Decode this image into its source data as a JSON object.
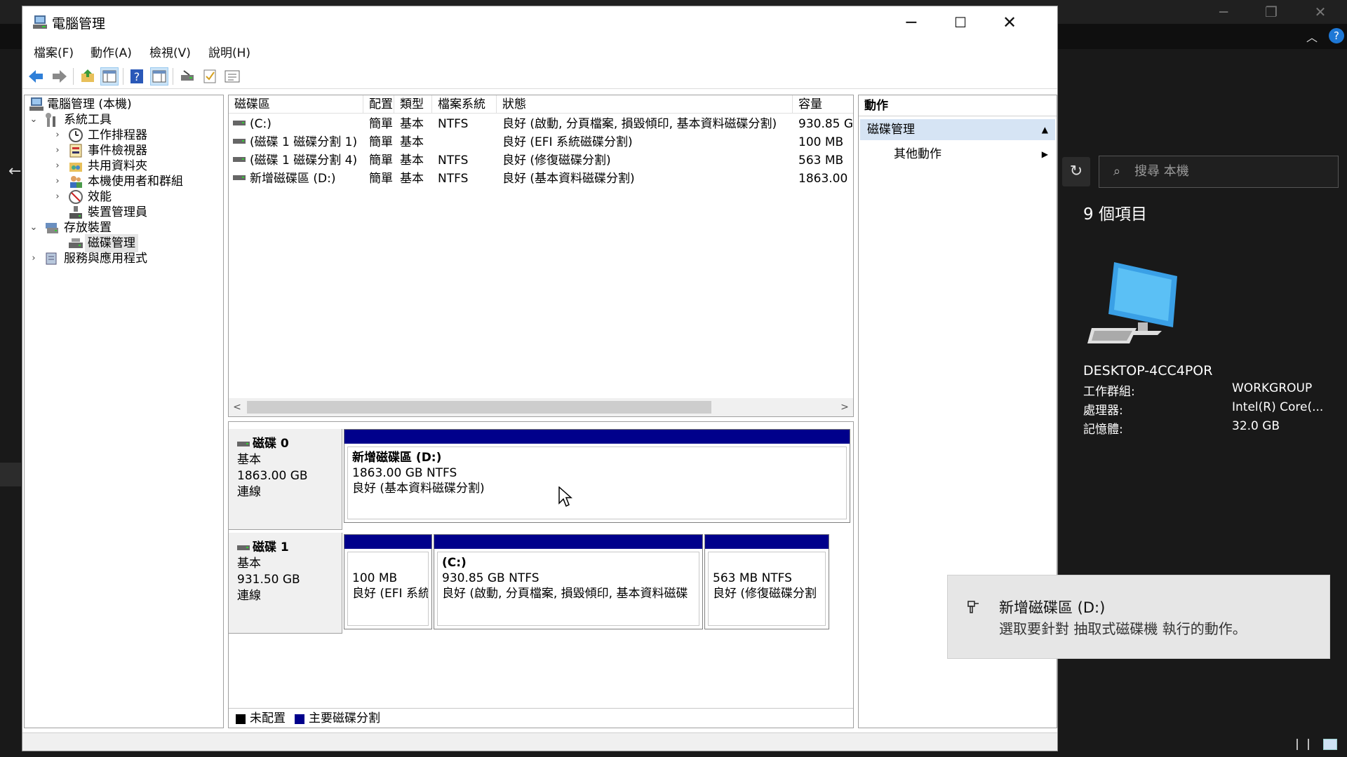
{
  "explorer": {
    "search_placeholder": "搜尋 本機",
    "item_count": "9 個項目",
    "pc_name": "DESKTOP-4CC4POR",
    "info": [
      {
        "key": "工作群組:",
        "value": "WORKGROUP"
      },
      {
        "key": "處理器:",
        "value": "Intel(R) Core(..."
      },
      {
        "key": "記憶體:",
        "value": "32.0 GB"
      }
    ]
  },
  "window": {
    "title": "電腦管理"
  },
  "menu": [
    "檔案(F)",
    "動作(A)",
    "檢視(V)",
    "說明(H)"
  ],
  "tree": {
    "root": "電腦管理 (本機)",
    "system_tools": "系統工具",
    "task_scheduler": "工作排程器",
    "event_viewer": "事件檢視器",
    "shared_folders": "共用資料夾",
    "local_users": "本機使用者和群組",
    "performance": "效能",
    "device_manager": "裝置管理員",
    "storage": "存放裝置",
    "disk_management": "磁碟管理",
    "services_apps": "服務與應用程式"
  },
  "list": {
    "headers": [
      "磁碟區",
      "配置",
      "類型",
      "檔案系統",
      "狀態",
      "容量"
    ],
    "rows": [
      [
        "(C:)",
        "簡單",
        "基本",
        "NTFS",
        "良好 (啟動, 分頁檔案, 損毀傾印, 基本資料磁碟分割)",
        "930.85 G"
      ],
      [
        "(磁碟 1 磁碟分割 1)",
        "簡單",
        "基本",
        "",
        "良好 (EFI 系統磁碟分割)",
        "100 MB"
      ],
      [
        "(磁碟 1 磁碟分割 4)",
        "簡單",
        "基本",
        "NTFS",
        "良好 (修復磁碟分割)",
        "563 MB"
      ],
      [
        "新增磁碟區 (D:)",
        "簡單",
        "基本",
        "NTFS",
        "良好 (基本資料磁碟分割)",
        "1863.00"
      ]
    ]
  },
  "disks": [
    {
      "name": "磁碟 0",
      "type": "基本",
      "size": "1863.00 GB",
      "status": "連線",
      "partitions": [
        {
          "name": "新增磁碟區 (D:)",
          "size": "1863.00 GB NTFS",
          "status": "良好 (基本資料磁碟分割)"
        }
      ]
    },
    {
      "name": "磁碟 1",
      "type": "基本",
      "size": "931.50 GB",
      "status": "連線",
      "partitions": [
        {
          "name": "",
          "size": "100 MB",
          "status": "良好 (EFI 系統"
        },
        {
          "name": "(C:)",
          "size": "930.85 GB NTFS",
          "status": "良好 (啟動, 分頁檔案, 損毀傾印, 基本資料磁碟"
        },
        {
          "name": "",
          "size": "563 MB NTFS",
          "status": "良好 (修復磁碟分割"
        }
      ]
    }
  ],
  "legend": {
    "unallocated": "未配置",
    "primary": "主要磁碟分割"
  },
  "actions": {
    "header": "動作",
    "section": "磁碟管理",
    "more": "其他動作"
  },
  "toast": {
    "title": "新增磁碟區 (D:)",
    "body": "選取要針對 抽取式磁碟機 執行的動作。"
  },
  "colors": {
    "primary_partition": "#00008b",
    "unallocated": "#000000",
    "action_section": "#d6e4f4"
  }
}
